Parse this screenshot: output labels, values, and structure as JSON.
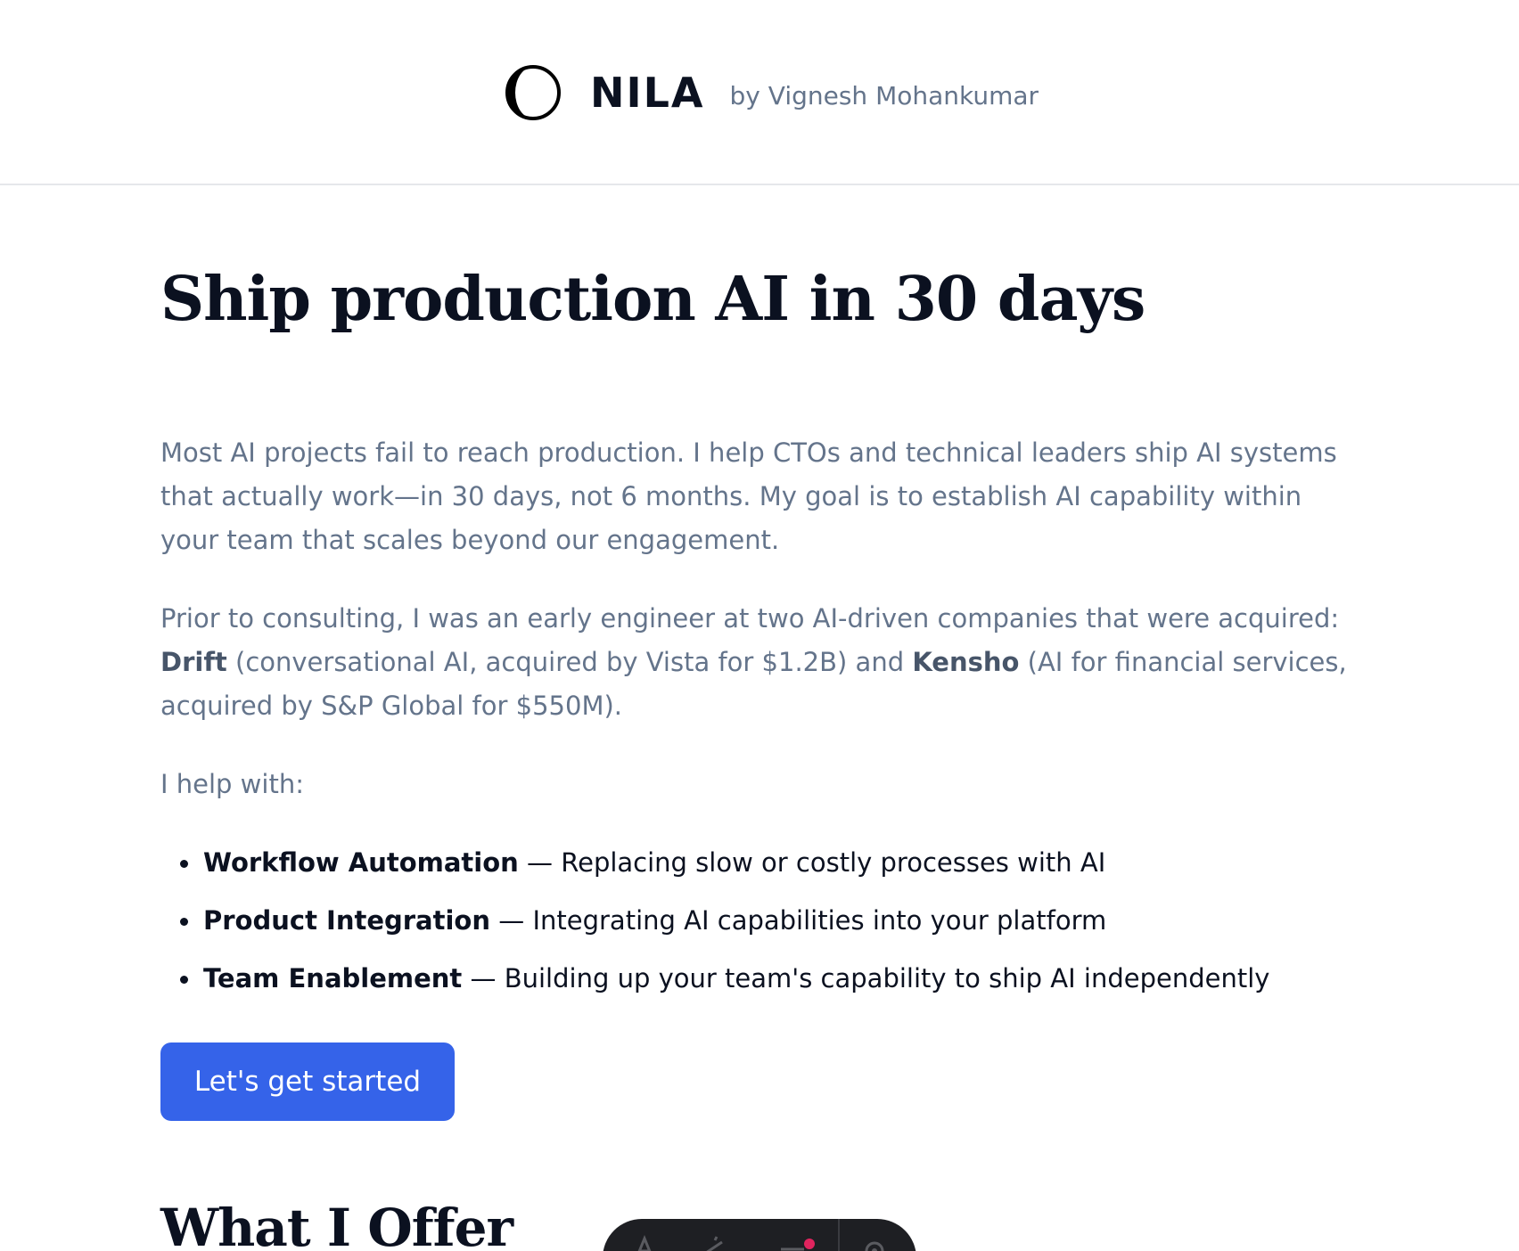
{
  "header": {
    "brand_name": "NILA",
    "byline": "by Vignesh Mohankumar"
  },
  "hero": {
    "title": "Ship production AI in 30 days"
  },
  "intro": {
    "paragraph1": "Most AI projects fail to reach production. I help CTOs and technical leaders ship AI systems that actually work—in 30 days, not 6 months. My goal is to establish AI capability within your team that scales beyond our engagement.",
    "p2_prefix": "Prior to consulting, I was an early engineer at two AI-driven companies that were acquired: ",
    "company1": "Drift",
    "p2_middle": " (conversational AI, acquired by Vista for $1.2B) and ",
    "company2": "Kensho",
    "p2_suffix": " (AI for financial services, acquired by S&P Global for $550M).",
    "help_with": "I help with:"
  },
  "services": [
    {
      "name": "Workflow Automation",
      "separator": " — ",
      "description": "Replacing slow or costly processes with AI"
    },
    {
      "name": "Product Integration",
      "separator": " — ",
      "description": "Integrating AI capabilities into your platform"
    },
    {
      "name": "Team Enablement",
      "separator": " — ",
      "description": "Building up your team's capability to ship AI independently"
    }
  ],
  "cta": {
    "label": "Let's get started"
  },
  "offer": {
    "title": "What I Offer"
  },
  "toolbar": {
    "icons": [
      "text-icon",
      "megaphone-icon",
      "settings-sliders-icon",
      "gear-icon"
    ],
    "notification_color": "#e0245e"
  },
  "colors": {
    "accent": "#3563e9",
    "heading": "#0b1120",
    "muted_text": "#64748b",
    "divider": "#e5e7eb"
  }
}
